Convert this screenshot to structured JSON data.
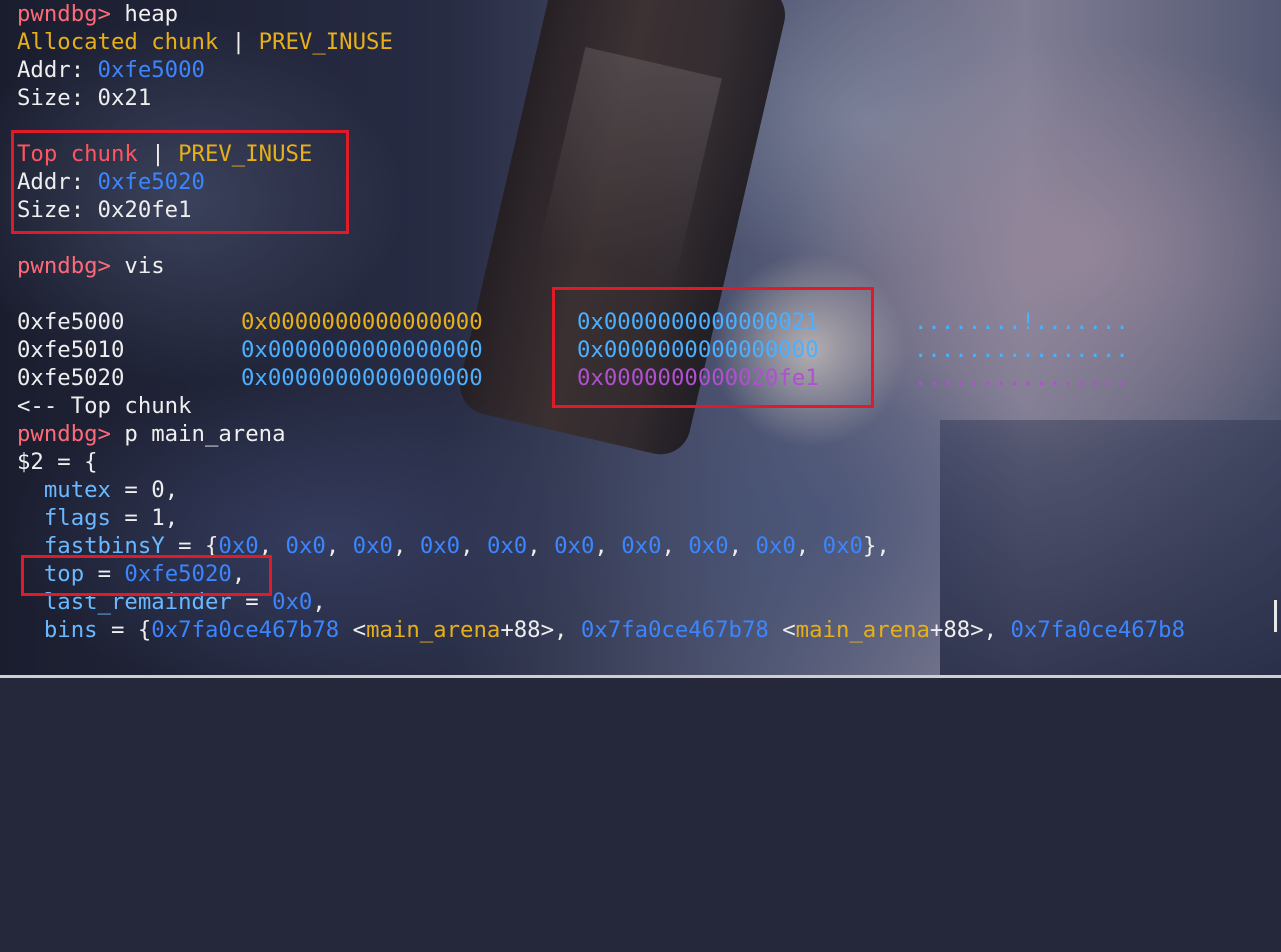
{
  "prompt": "pwndbg>",
  "lines": {
    "cmd_heap": "heap",
    "alloc_label": "Allocated chunk",
    "sep": " | ",
    "prev_inuse": "PREV_INUSE",
    "addr_label": "Addr: ",
    "size_label": "Size: ",
    "alloc_addr": "0xfe5000",
    "alloc_size": "0x21",
    "top_label": "Top chunk",
    "top_addr": "0xfe5020",
    "top_size": "0x20fe1",
    "cmd_vis": "vis",
    "top_chunk_marker": "<-- Top chunk",
    "cmd_print": "p main_arena",
    "result_open": "$2 = {",
    "mutex_field": "mutex",
    "mutex_val": "0",
    "flags_field": "flags",
    "flags_val": "1",
    "fastbins_field": "fastbinsY",
    "top_field": "top",
    "top_val": "0xfe5020",
    "last_field": "last_remainder",
    "last_val": "0x0",
    "bins_field": "bins",
    "bins_addr": "0x7fa0ce467b78",
    "bins_sym": "main_arena",
    "bins_off": "+88",
    "bins_addr_3": "0x7fa0ce467b8"
  },
  "fastbins": [
    "0x0",
    "0x0",
    "0x0",
    "0x0",
    "0x0",
    "0x0",
    "0x0",
    "0x0",
    "0x0",
    "0x0"
  ],
  "vis_rows": [
    {
      "addr": "0xfe5000",
      "q1": "0x0000000000000000",
      "q2": "0x0000000000000021",
      "ascii": "........!......."
    },
    {
      "addr": "0xfe5010",
      "q1": "0x0000000000000000",
      "q2": "0x0000000000000000",
      "ascii": "................"
    },
    {
      "addr": "0xfe5020",
      "q1": "0x0000000000000000",
      "q2": "0x0000000000020fe1",
      "ascii": "................"
    }
  ],
  "colors": {
    "prompt": "#ff6a78",
    "yellow": "#e8b018",
    "blue": "#3b86ff",
    "highlight_box": "#e01a26"
  }
}
